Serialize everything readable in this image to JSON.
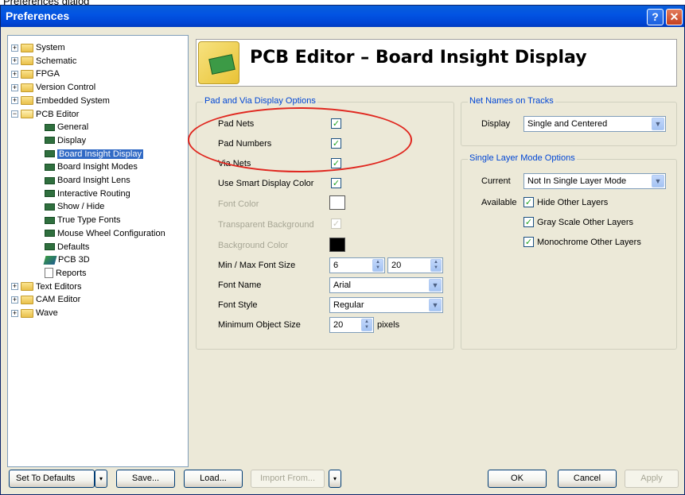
{
  "caption": "Preferences dialog",
  "window": {
    "title": "Preferences",
    "help_label": "?",
    "close_label": "✕"
  },
  "tree": {
    "items": [
      {
        "label": "System",
        "kind": "folder",
        "expander": "+",
        "depth": 0
      },
      {
        "label": "Schematic",
        "kind": "folder",
        "expander": "+",
        "depth": 0
      },
      {
        "label": "FPGA",
        "kind": "folder",
        "expander": "+",
        "depth": 0
      },
      {
        "label": "Version Control",
        "kind": "folder",
        "expander": "+",
        "depth": 0
      },
      {
        "label": "Embedded System",
        "kind": "folder",
        "expander": "+",
        "depth": 0
      },
      {
        "label": "PCB Editor",
        "kind": "folder-open",
        "expander": "−",
        "depth": 0
      },
      {
        "label": "General",
        "kind": "pcb",
        "depth": 1
      },
      {
        "label": "Display",
        "kind": "pcb",
        "depth": 1
      },
      {
        "label": "Board Insight Display",
        "kind": "pcb",
        "depth": 1,
        "selected": true
      },
      {
        "label": "Board Insight Modes",
        "kind": "pcb",
        "depth": 1
      },
      {
        "label": "Board Insight Lens",
        "kind": "pcb",
        "depth": 1
      },
      {
        "label": "Interactive Routing",
        "kind": "pcb",
        "depth": 1
      },
      {
        "label": "Show / Hide",
        "kind": "pcb",
        "depth": 1
      },
      {
        "label": "True Type Fonts",
        "kind": "pcb",
        "depth": 1
      },
      {
        "label": "Mouse Wheel Configuration",
        "kind": "pcb",
        "depth": 1
      },
      {
        "label": "Defaults",
        "kind": "pcb",
        "depth": 1
      },
      {
        "label": "PCB 3D",
        "kind": "pcb3d",
        "depth": 1
      },
      {
        "label": "Reports",
        "kind": "doc",
        "depth": 1
      },
      {
        "label": "Text Editors",
        "kind": "folder",
        "expander": "+",
        "depth": 0
      },
      {
        "label": "CAM Editor",
        "kind": "folder",
        "expander": "+",
        "depth": 0
      },
      {
        "label": "Wave",
        "kind": "folder",
        "expander": "+",
        "depth": 0
      }
    ]
  },
  "header": {
    "title": "PCB Editor – Board Insight Display"
  },
  "pad_via": {
    "group_title": "Pad and Via Display Options",
    "pad_nets": {
      "label": "Pad Nets",
      "checked": "✓"
    },
    "pad_numbers": {
      "label": "Pad Numbers",
      "checked": "✓"
    },
    "via_nets": {
      "label": "Via Nets",
      "checked": "✓"
    },
    "smart_color": {
      "label": "Use Smart Display Color",
      "checked": "✓"
    },
    "font_color": {
      "label": "Font Color",
      "swatch": "#ffffff"
    },
    "transparent_bg": {
      "label": "Transparent Background",
      "checked": "✓"
    },
    "bg_color": {
      "label": "Background Color",
      "swatch": "#000000"
    },
    "min_max_font": {
      "label": "Min / Max Font Size",
      "min": "6",
      "max": "20"
    },
    "font_name": {
      "label": "Font Name",
      "value": "Arial"
    },
    "font_style": {
      "label": "Font Style",
      "value": "Regular"
    },
    "min_object": {
      "label": "Minimum Object Size",
      "value": "20",
      "unit": "pixels"
    }
  },
  "net_names": {
    "group_title": "Net Names on Tracks",
    "display_label": "Display",
    "display_value": "Single and Centered"
  },
  "single_layer": {
    "group_title": "Single Layer Mode Options",
    "current_label": "Current",
    "current_value": "Not In Single Layer Mode",
    "available_label": "Available",
    "hide_other": {
      "label": "Hide Other Layers",
      "checked": "✓"
    },
    "gray_scale": {
      "label": "Gray Scale Other Layers",
      "checked": "✓"
    },
    "monochrome": {
      "label": "Monochrome Other Layers",
      "checked": "✓"
    }
  },
  "footer": {
    "set_defaults": "Set To Defaults",
    "save": "Save...",
    "load": "Load...",
    "import_from": "Import From...",
    "ok": "OK",
    "cancel": "Cancel",
    "apply": "Apply",
    "split_arrow": "▾"
  },
  "glyphs": {
    "dropdown": "▼",
    "spin_up": "▲",
    "spin_down": "▼"
  },
  "colors": {
    "annotation_oval": "#e0261e",
    "selection": "#316ac5",
    "group_title": "#0046d5"
  }
}
